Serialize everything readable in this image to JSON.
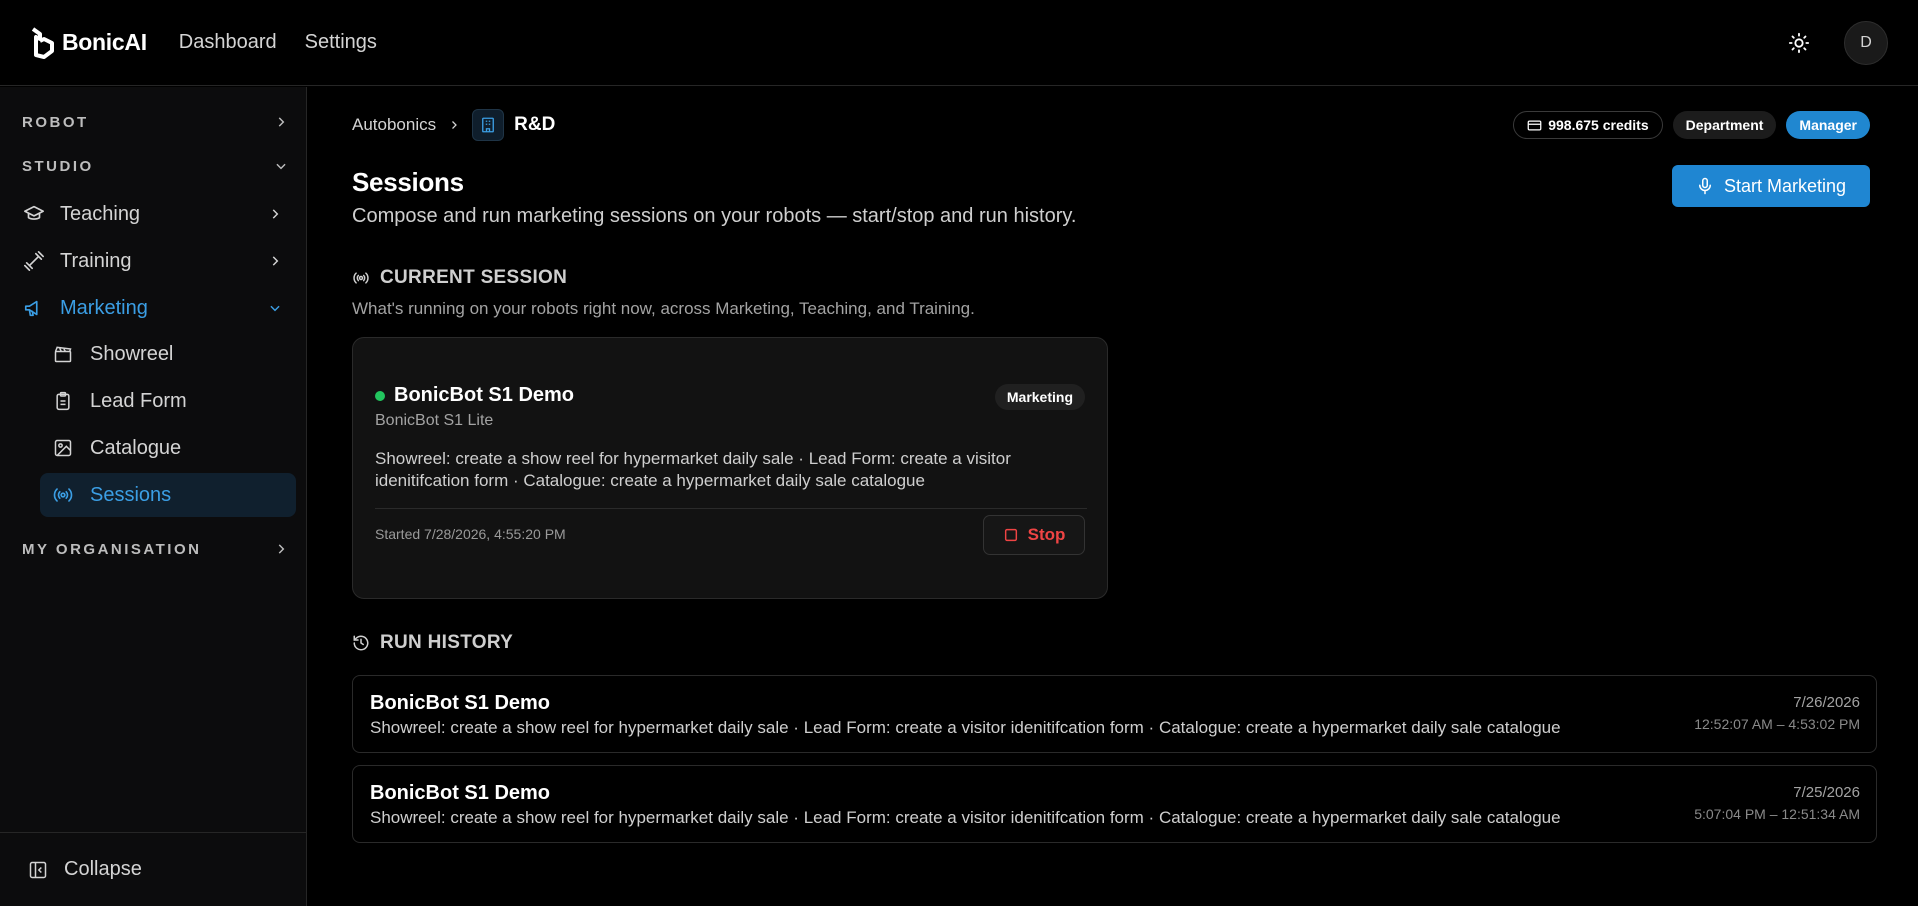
{
  "app": {
    "name": "BonicAI"
  },
  "topnav": {
    "dashboard": "Dashboard",
    "settings": "Settings"
  },
  "user": {
    "initial": "D"
  },
  "sidebar": {
    "robot": "ROBOT",
    "studio": "STUDIO",
    "items": [
      {
        "label": "Teaching",
        "icon": "graduation-cap-icon"
      },
      {
        "label": "Training",
        "icon": "dumbbell-icon"
      },
      {
        "label": "Marketing",
        "icon": "megaphone-icon"
      }
    ],
    "marketing_sub": [
      {
        "label": "Showreel",
        "icon": "clapperboard-icon"
      },
      {
        "label": "Lead Form",
        "icon": "clipboard-icon"
      },
      {
        "label": "Catalogue",
        "icon": "image-icon"
      },
      {
        "label": "Sessions",
        "icon": "radio-icon"
      }
    ],
    "my_org": "MY ORGANISATION",
    "collapse": "Collapse"
  },
  "breadcrumb": {
    "org": "Autobonics",
    "current": "R&D"
  },
  "badges": {
    "credits": "998.675 credits",
    "department": "Department",
    "role": "Manager"
  },
  "page": {
    "title": "Sessions",
    "subtitle": "Compose and run marketing sessions on your robots — start/stop and run history.",
    "start_button": "Start Marketing"
  },
  "current_session": {
    "heading": "CURRENT SESSION",
    "description": "What's running on your robots right now, across Marketing, Teaching, and Training.",
    "robot_name": "BonicBot S1 Demo",
    "model": "BonicBot S1 Lite",
    "type": "Marketing",
    "details": "Showreel: create a show reel for hypermarket daily sale · Lead Form: create a visitor idenitifcation form · Catalogue: create a hypermarket daily sale catalogue",
    "started": "Started 7/28/2026, 4:55:20 PM",
    "stop_label": "Stop",
    "status_color": "#22c55e"
  },
  "run_history": {
    "heading": "RUN HISTORY",
    "runs": [
      {
        "robot_name": "BonicBot S1 Demo",
        "details": "Showreel: create a show reel for hypermarket daily sale · Lead Form: create a visitor idenitifcation form · Catalogue: create a hypermarket daily sale catalogue",
        "date": "7/26/2026",
        "time_range": "12:52:07 AM – 4:53:02 PM"
      },
      {
        "robot_name": "BonicBot S1 Demo",
        "details": "Showreel: create a show reel for hypermarket daily sale · Lead Form: create a visitor idenitifcation form · Catalogue: create a hypermarket daily sale catalogue",
        "date": "7/25/2026",
        "time_range": "5:07:04 PM – 12:51:34 AM"
      }
    ]
  },
  "colors": {
    "accent": "#1f86d2",
    "active_text": "#3b9ee4",
    "danger": "#ef4444"
  }
}
